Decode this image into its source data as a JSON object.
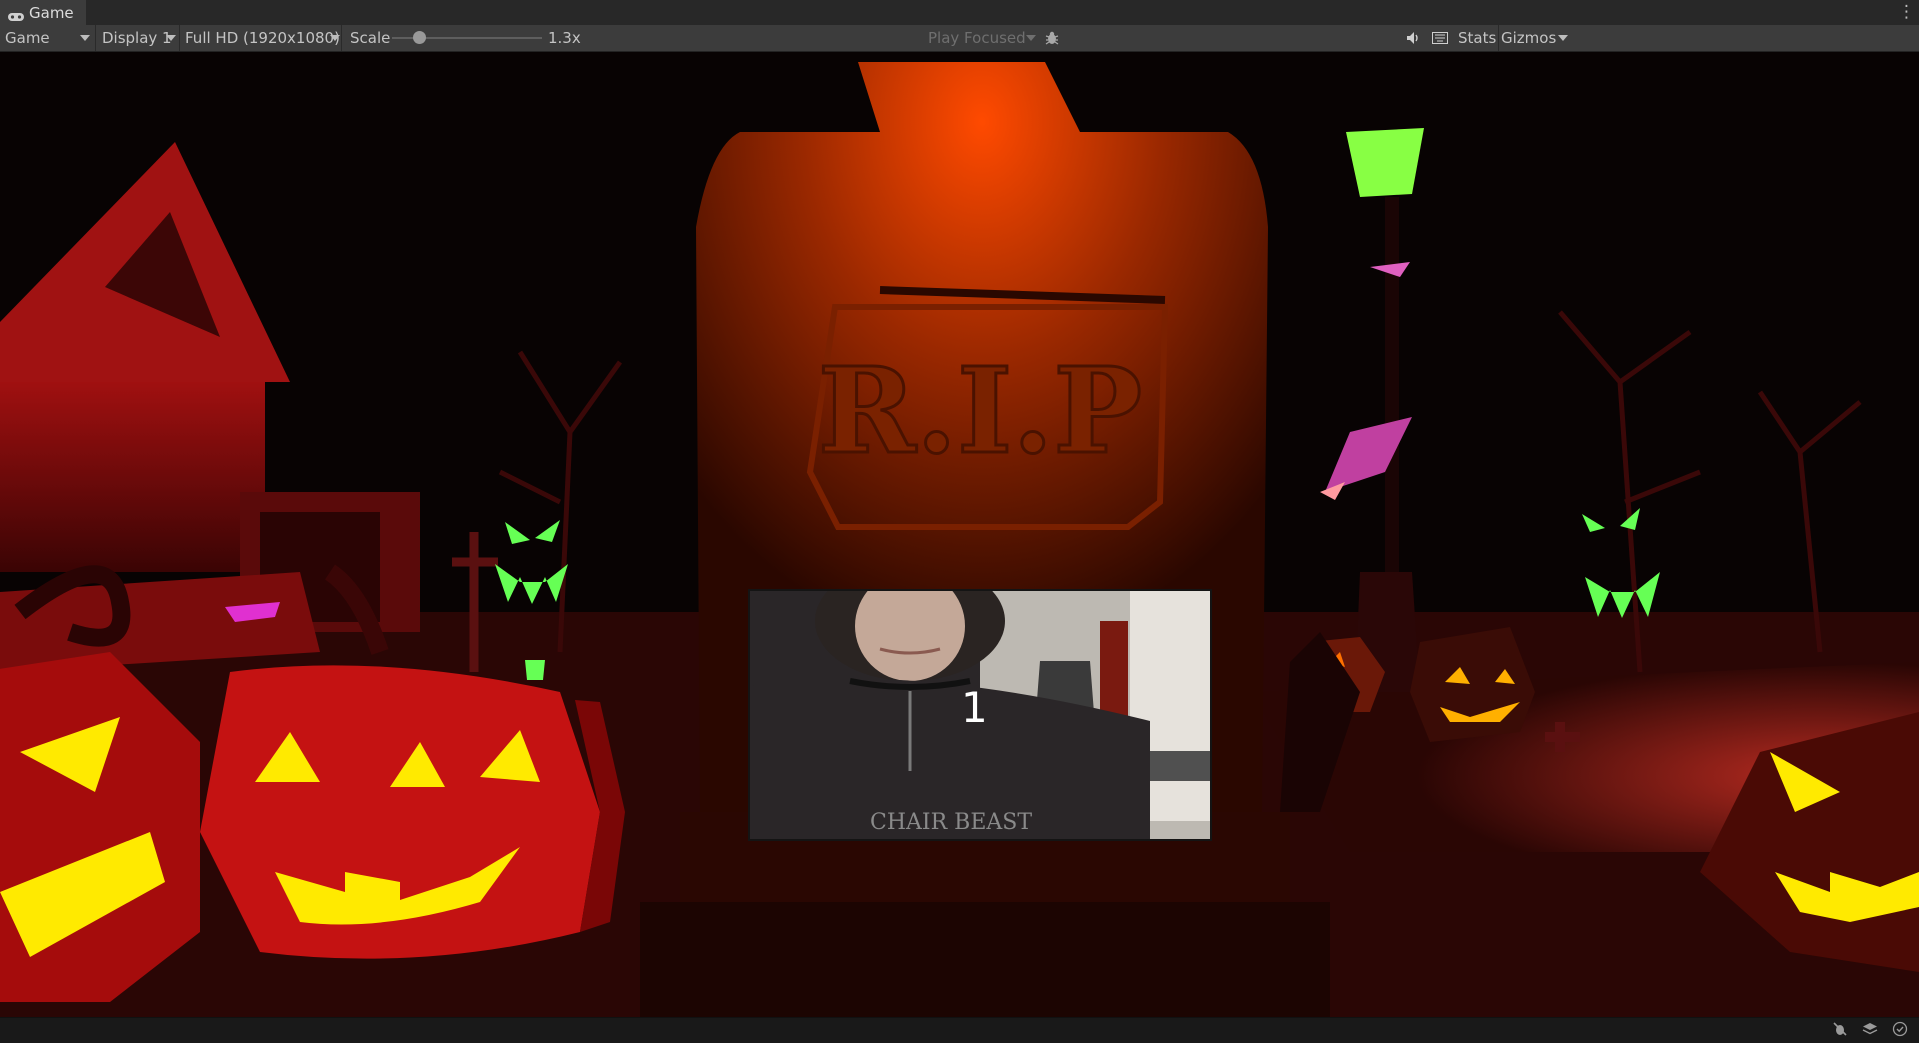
{
  "window": {
    "tab_title": "Game",
    "tab_menu_icon": "kebab-menu-icon"
  },
  "toolbar": {
    "mode_label": "Game",
    "display_label": "Display 1",
    "resolution_label": "Full HD (1920x1080)",
    "scale_label": "Scale",
    "scale_value": "1.3x",
    "scale_fraction": 0.13,
    "play_mode_label": "Play Focused",
    "stats_label": "Stats",
    "gizmos_label": "Gizmos",
    "icons": {
      "tab": "gamepad-icon",
      "debug": "bug-icon",
      "audio": "speaker-icon",
      "keyboard": "keyboard-icon"
    }
  },
  "scene": {
    "tombstone_text": "R.I.P",
    "countdown": "1",
    "colors": {
      "tombstone": "#a83200",
      "ground": "#8a1a10",
      "pumpkin": "#b50e0e",
      "pumpkin_face": "#ffea00",
      "ghost_face": "#66ff55",
      "lamp": "#88ff44",
      "accent_pink": "#e060c0"
    }
  },
  "statusbar": {
    "icons": [
      "debug-off-icon",
      "layers-icon",
      "check-circle-icon"
    ]
  }
}
